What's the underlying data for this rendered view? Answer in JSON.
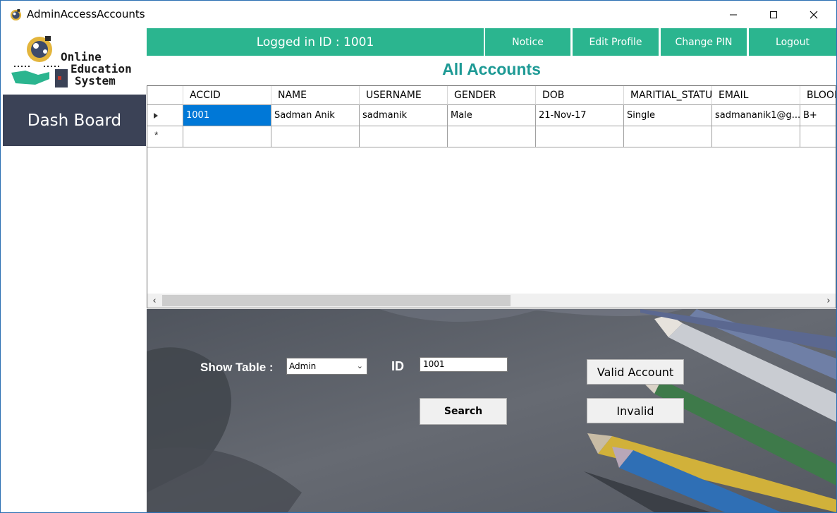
{
  "window": {
    "title": "AdminAccessAccounts"
  },
  "sidebar": {
    "logo": {
      "line1": "Online",
      "line2": "Education",
      "line3": "System"
    },
    "dashboard_label": "Dash Board"
  },
  "topbar": {
    "logged_in": "Logged in ID : 1001",
    "notice": "Notice",
    "edit_profile": "Edit Profile",
    "change_pin": "Change PIN",
    "logout": "Logout"
  },
  "main": {
    "title": "All Accounts"
  },
  "grid": {
    "columns": [
      "ACCID",
      "NAME",
      "USERNAME",
      "GENDER",
      "DOB",
      "MARITIAL_STATU",
      "EMAIL",
      "BLOOD"
    ],
    "rows": [
      [
        "1001",
        "Sadman Anik",
        "sadmanik",
        "Male",
        "21-Nov-17",
        "Single",
        "sadmananik1@g...",
        "B+"
      ]
    ],
    "new_row_marker": "*"
  },
  "panel": {
    "show_table_label": "Show Table :",
    "show_table_value": "Admin",
    "id_label": "ID",
    "id_value": "1001",
    "search_label": "Search",
    "valid_label": "Valid Account",
    "invalid_label": "Invalid"
  },
  "colors": {
    "accent": "#2bb58f",
    "title": "#1e9a95",
    "sidebar_button": "#3b4256",
    "selection": "#0078d7"
  }
}
